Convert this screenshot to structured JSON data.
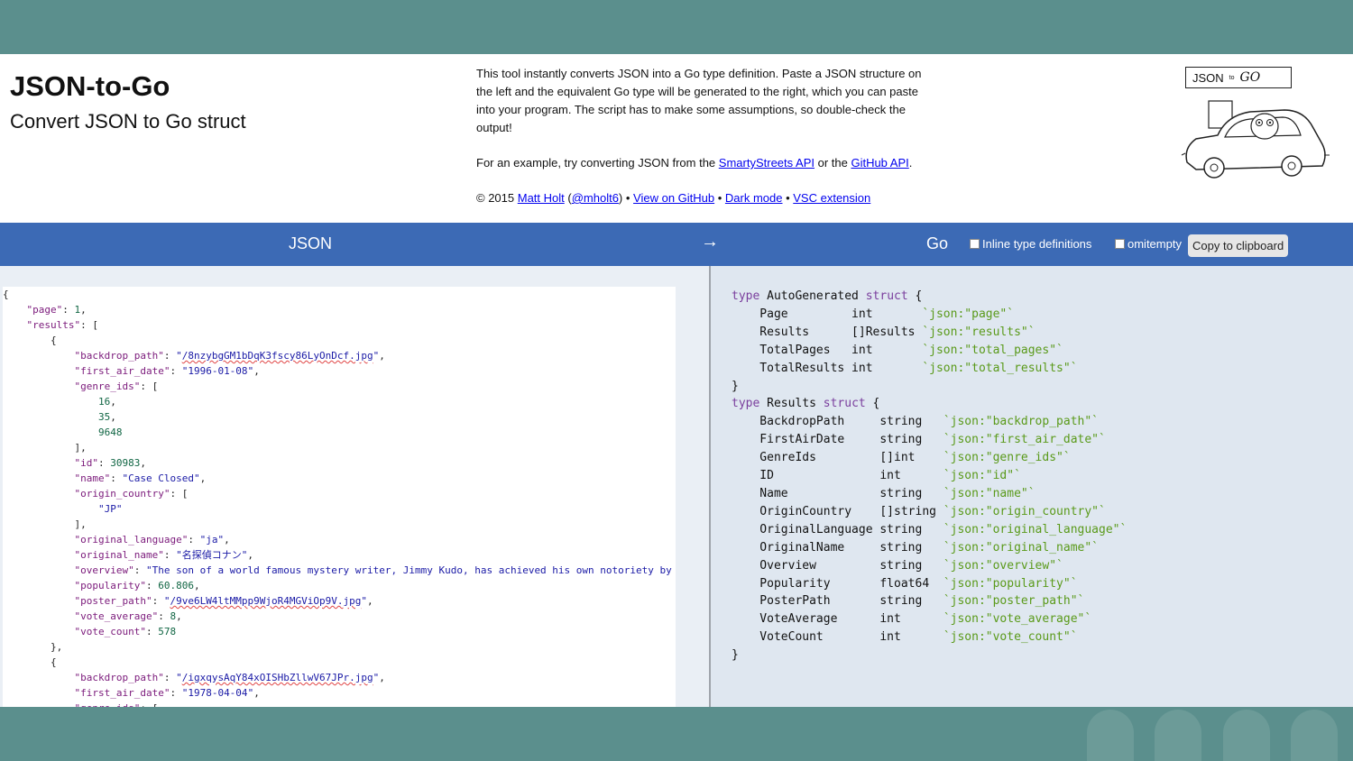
{
  "header": {
    "title": "JSON-to-Go",
    "subtitle": "Convert JSON to Go struct",
    "description": "This tool instantly converts JSON into a Go type definition. Paste a JSON structure on the left and the equivalent Go type will be generated to the right, which you can paste into your program. The script has to make some assumptions, so double-check the output!",
    "example_prefix": "For an example, try converting JSON from the ",
    "example_link1": "SmartyStreets API",
    "example_mid": " or the ",
    "example_link2": "GitHub API",
    "example_suffix": ".",
    "copyright": "© 2015 ",
    "author_link": "Matt Holt",
    "handle_link": "@mholt6",
    "github_link": "View on GitHub",
    "darkmode_link": "Dark mode",
    "vsc_link": "VSC extension",
    "logo_json": "JSON",
    "logo_to": "to",
    "logo_go": "GO"
  },
  "toolbar": {
    "json_label": "JSON",
    "arrow": "→",
    "go_label": "Go",
    "inline_label": "Inline type definitions",
    "omitempty_label": "omitempty",
    "copy_label": "Copy to clipboard"
  },
  "colors": {
    "frame": "#5b8f8d",
    "toolbar": "#3c6ab5",
    "output_bg": "#dfe7f0",
    "keyword": "#7a3e9d",
    "tag": "#5a9a1a"
  },
  "json_input": [
    "{",
    "    \"page\": 1,",
    "    \"results\": [",
    "        {",
    "            \"backdrop_path\": \"/8nzybgGM1bDqK3fscy86LyOnDcf.jpg\",",
    "            \"first_air_date\": \"1996-01-08\",",
    "            \"genre_ids\": [",
    "                16,",
    "                35,",
    "                9648",
    "            ],",
    "            \"id\": 30983,",
    "            \"name\": \"Case Closed\",",
    "            \"origin_country\": [",
    "                \"JP\"",
    "            ],",
    "            \"original_language\": \"ja\",",
    "            \"original_name\": \"名探偵コナン\",",
    "            \"overview\": \"The son of a world famous mystery writer, Jimmy Kudo, has achieved his own notoriety by assisting the local police\",",
    "            \"popularity\": 60.806,",
    "            \"poster_path\": \"/9ve6LW4ltMMpp9WjoR4MGViOp9V.jpg\",",
    "            \"vote_average\": 8,",
    "            \"vote_count\": 578",
    "        },",
    "        {",
    "            \"backdrop_path\": \"/igxqysAqY84xOISHbZllwV67JPr.jpg\",",
    "            \"first_air_date\": \"1978-04-04\",",
    "            \"genre_ids\": ["
  ],
  "go_output": [
    "type AutoGenerated struct {",
    "    Page         int       `json:\"page\"`",
    "    Results      []Results `json:\"results\"`",
    "    TotalPages   int       `json:\"total_pages\"`",
    "    TotalResults int       `json:\"total_results\"`",
    "}",
    "type Results struct {",
    "    BackdropPath     string   `json:\"backdrop_path\"`",
    "    FirstAirDate     string   `json:\"first_air_date\"`",
    "    GenreIds         []int    `json:\"genre_ids\"`",
    "    ID               int      `json:\"id\"`",
    "    Name             string   `json:\"name\"`",
    "    OriginCountry    []string `json:\"origin_country\"`",
    "    OriginalLanguage string   `json:\"original_language\"`",
    "    OriginalName     string   `json:\"original_name\"`",
    "    Overview         string   `json:\"overview\"`",
    "    Popularity       float64  `json:\"popularity\"`",
    "    PosterPath       string   `json:\"poster_path\"`",
    "    VoteAverage      int      `json:\"vote_average\"`",
    "    VoteCount        int      `json:\"vote_count\"`",
    "}"
  ]
}
